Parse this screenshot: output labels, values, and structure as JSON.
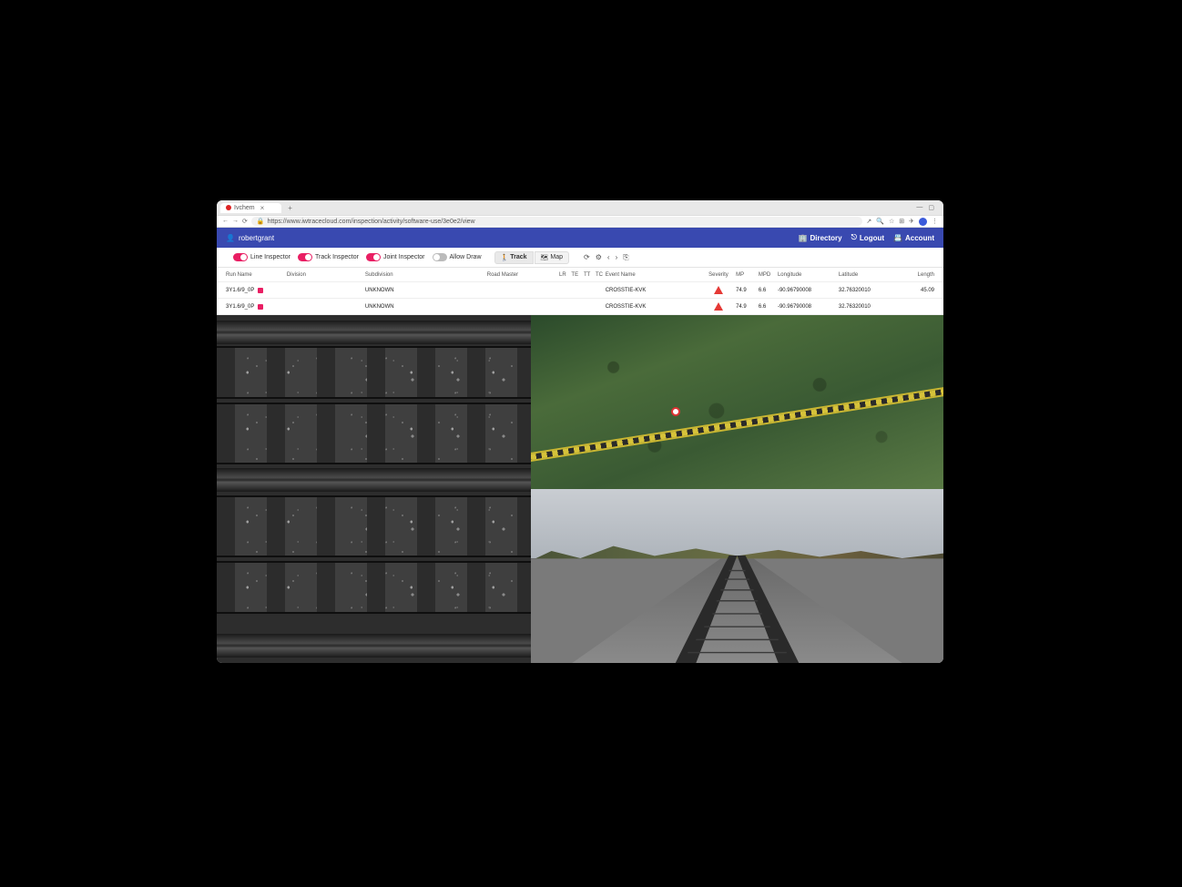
{
  "browser": {
    "tab_title": "Ivchem",
    "url": "https://www.iwtracecloud.com/inspection/activity/software-use/3e0e2/view"
  },
  "appbar": {
    "user": "robertgrant",
    "directory": "Directory",
    "logout": "Logout",
    "account": "Account"
  },
  "toolbar": {
    "line_inspector": "Line Inspector",
    "track_inspector": "Track Inspector",
    "joint_inspector": "Joint Inspector",
    "allow_draw": "Allow Draw",
    "track_btn": "Track",
    "map_btn": "Map"
  },
  "table": {
    "headers": {
      "run": "Run Name",
      "div": "Division",
      "sub": "Subdivision",
      "rm": "Road Master",
      "lr": "LR",
      "te": "TE",
      "tt": "TT",
      "tc": "TC",
      "ev": "Event Name",
      "sev": "Severity",
      "mp": "MP",
      "mpd": "MPD",
      "lng": "Longitude",
      "lat": "Latitude",
      "len": "Length"
    },
    "rows": [
      {
        "run": "3Y1.6/9_0P",
        "sub": "UNKNOWN",
        "ev": "CROSSTIE-KVK",
        "mp": "74.9",
        "mpd": "6.6",
        "lng": "-90.96790008",
        "lat": "32.76320010",
        "len": "45.09"
      },
      {
        "run": "3Y1.6/9_0P",
        "sub": "UNKNOWN",
        "ev": "CROSSTIE-KVK",
        "mp": "74.9",
        "mpd": "6.6",
        "lng": "-90.96790008",
        "lat": "32.76320010",
        "len": ""
      }
    ]
  }
}
